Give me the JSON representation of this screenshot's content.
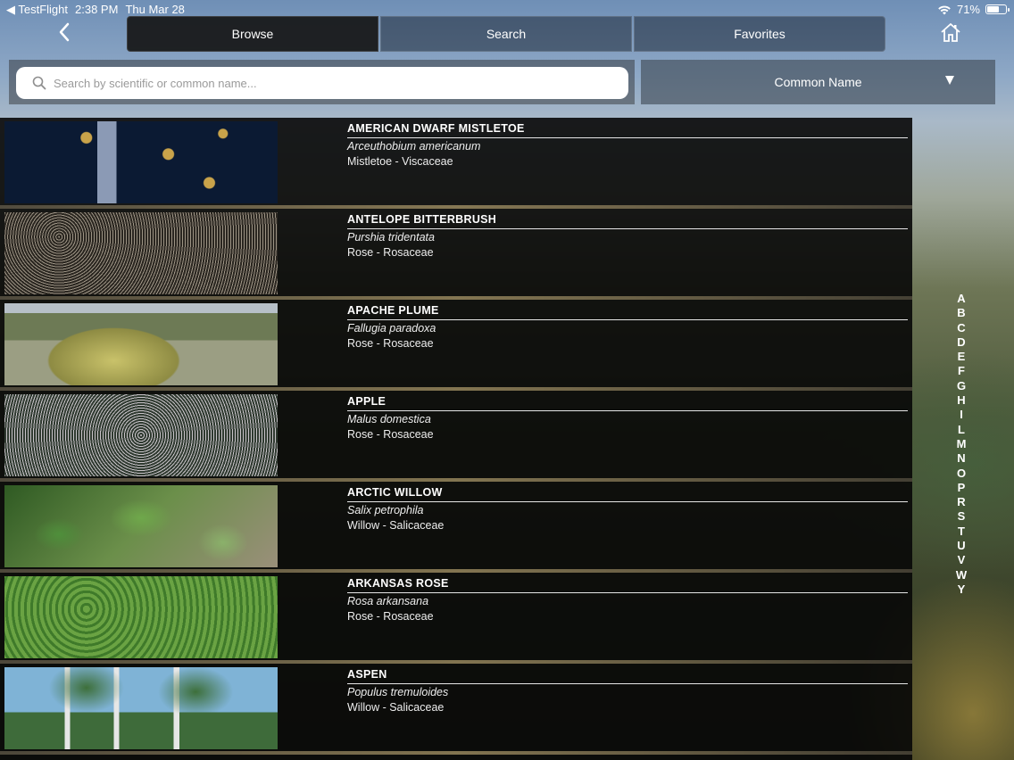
{
  "status_bar": {
    "back_app": "◀ TestFlight",
    "time": "2:38 PM",
    "date": "Thu Mar 28",
    "battery": "71%",
    "battery_level": 0.71
  },
  "nav": {
    "back_icon": "chevron-left-icon",
    "home_icon": "home-icon",
    "tabs": [
      {
        "label": "Browse",
        "active": true
      },
      {
        "label": "Search",
        "active": false
      },
      {
        "label": "Favorites",
        "active": false
      }
    ]
  },
  "search": {
    "placeholder": "Search by scientific or common name...",
    "value": ""
  },
  "sort": {
    "selected": "Common Name"
  },
  "plants": [
    {
      "common": "AMERICAN DWARF MISTLETOE",
      "scientific": "Arceuthobium americanum",
      "family": "Mistletoe - Viscaceae"
    },
    {
      "common": "ANTELOPE BITTERBRUSH",
      "scientific": "Purshia tridentata",
      "family": "Rose - Rosaceae"
    },
    {
      "common": "APACHE PLUME",
      "scientific": "Fallugia paradoxa",
      "family": "Rose - Rosaceae"
    },
    {
      "common": "APPLE",
      "scientific": "Malus domestica",
      "family": "Rose - Rosaceae"
    },
    {
      "common": "ARCTIC WILLOW",
      "scientific": "Salix petrophila",
      "family": "Willow - Salicaceae"
    },
    {
      "common": "ARKANSAS ROSE",
      "scientific": "Rosa arkansana",
      "family": "Rose - Rosaceae"
    },
    {
      "common": "ASPEN",
      "scientific": "Populus tremuloides",
      "family": "Willow - Salicaceae"
    }
  ],
  "alpha_index": [
    "A",
    "B",
    "C",
    "D",
    "E",
    "F",
    "G",
    "H",
    "I",
    "L",
    "M",
    "N",
    "O",
    "P",
    "R",
    "S",
    "T",
    "U",
    "V",
    "W",
    "Y"
  ]
}
